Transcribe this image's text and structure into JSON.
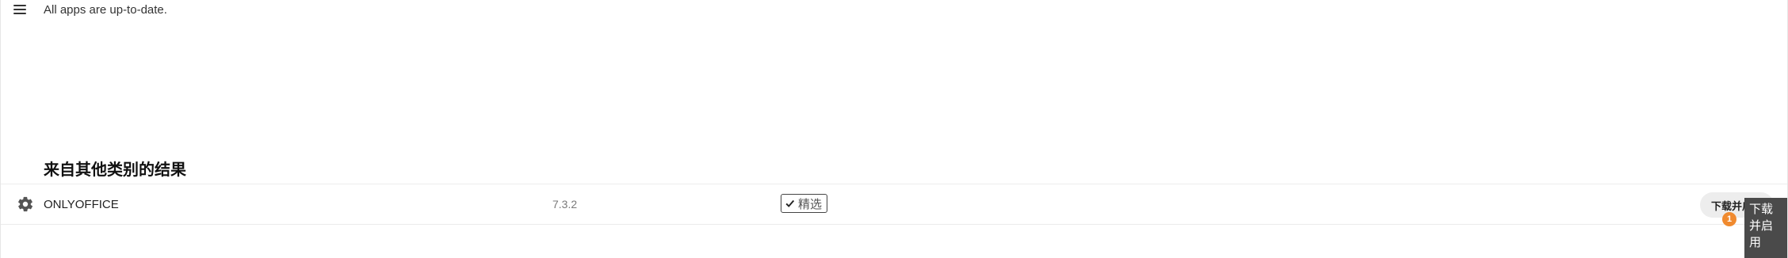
{
  "topbar": {
    "menu_icon": "hamburger-menu-icon",
    "status": "All apps are up-to-date."
  },
  "section": {
    "title": "来自其他类别的结果"
  },
  "apps": [
    {
      "icon": "gear-icon",
      "name": "ONLYOFFICE",
      "version": "7.3.2",
      "badge_icon": "check-icon",
      "badge_label": "精选",
      "action_label": "下载并启用"
    }
  ],
  "notification": {
    "count": "1",
    "color": "#f08a2f"
  },
  "tooltip": {
    "text": "下载并启用"
  }
}
